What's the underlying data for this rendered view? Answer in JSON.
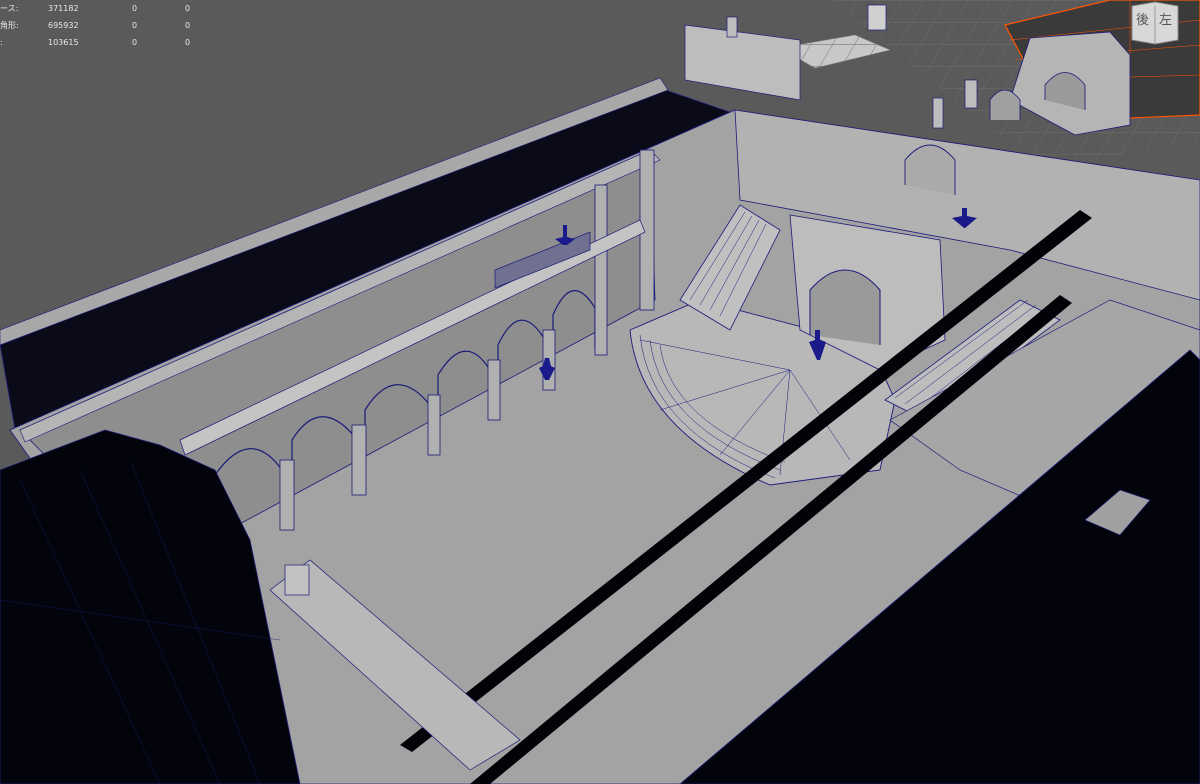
{
  "hud": {
    "rows": [
      {
        "label": "ース:",
        "v1": "371182",
        "v2": "0",
        "v3": "0"
      },
      {
        "label": "角形:",
        "v1": "695932",
        "v2": "0",
        "v3": "0"
      },
      {
        "label": ":",
        "v1": "103615",
        "v2": "0",
        "v3": "0"
      }
    ]
  },
  "viewcube": {
    "face_left": "後",
    "face_right": "左"
  },
  "colors": {
    "background": "#5a5a5a",
    "mesh_fill": "#9e9e9e",
    "wireframe": "#1a1a7a",
    "backface": "#050510",
    "selection": "#ff5500"
  }
}
